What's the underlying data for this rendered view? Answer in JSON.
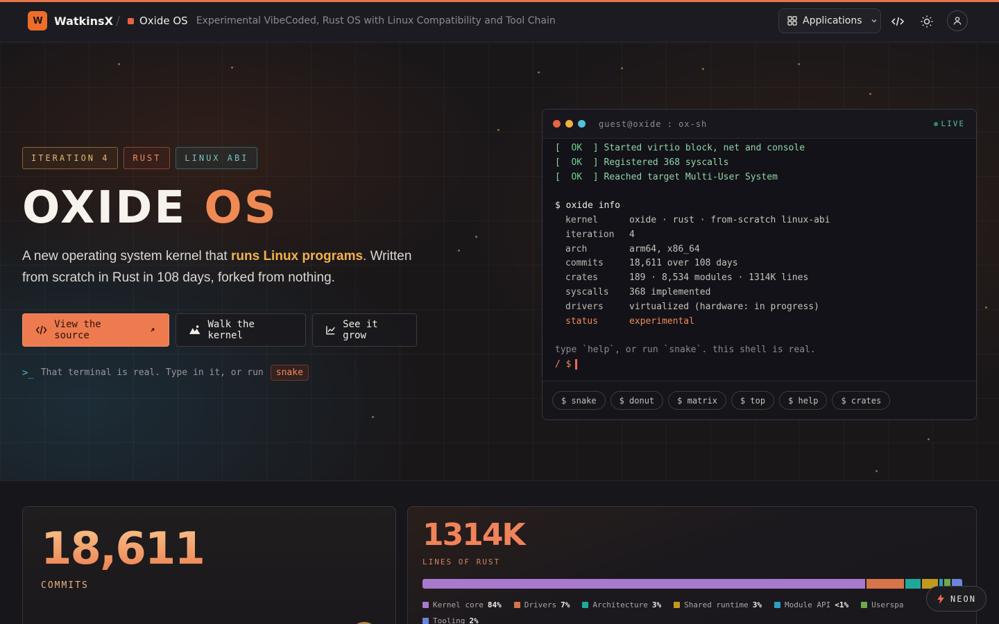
{
  "navbar": {
    "brand_name": "WatkinsX",
    "crumb_title": "Oxide OS",
    "crumb_desc": "Experimental VibeCoded, Rust OS with Linux Compatibility and Tool Chain",
    "apps_label": "Applications"
  },
  "hero": {
    "tags": [
      "ITERATION 4",
      "RUST",
      "LINUX ABI"
    ],
    "title_main": "OXIDE",
    "title_accent": "OS",
    "desc_before": "A new operating system kernel that ",
    "desc_highlight": "runs Linux programs",
    "desc_after": ". Written from scratch in Rust in 108 days, forked from nothing.",
    "buttons": {
      "source": "View the source",
      "walk": "Walk the kernel",
      "grow": "See it grow"
    },
    "hint_text": "That terminal is real. Type in it, or run",
    "hint_chip": "snake"
  },
  "terminal": {
    "title": "guest@oxide : ox-sh",
    "live": "LIVE",
    "boot": [
      {
        "status": "OK",
        "text": "Started virtio block, net and console"
      },
      {
        "status": "OK",
        "text": "Registered 368 syscalls"
      },
      {
        "status": "OK",
        "text": "Reached target Multi-User System"
      }
    ],
    "command": "$ oxide info",
    "info": [
      {
        "k": "kernel",
        "v": "oxide · rust · from-scratch linux-abi"
      },
      {
        "k": "iteration",
        "v": "4"
      },
      {
        "k": "arch",
        "v": "arm64, x86_64"
      },
      {
        "k": "commits",
        "v": "18,611 over 108 days"
      },
      {
        "k": "crates",
        "v": "189 · 8,534 modules · 1314K lines"
      },
      {
        "k": "syscalls",
        "v": "368 implemented"
      },
      {
        "k": "drivers",
        "v": "virtualized (hardware: in progress)"
      },
      {
        "k": "status",
        "v": "experimental"
      }
    ],
    "help_line": "type `help`, or run `snake`. this shell is real.",
    "prompt": "/ $",
    "chips": [
      "$ snake",
      "$ donut",
      "$ matrix",
      "$ top",
      "$ help",
      "$ crates"
    ]
  },
  "stats": {
    "commits_value": "18,611",
    "commits_label": "COMMITS",
    "lines_value": "1314K",
    "lines_label": "LINES OF RUST",
    "breakdown": [
      {
        "name": "Kernel core",
        "pct": "84%",
        "share": 84,
        "color": "#a879cc"
      },
      {
        "name": "Drivers",
        "pct": "7%",
        "share": 7,
        "color": "#d8744a"
      },
      {
        "name": "Architecture",
        "pct": "3%",
        "share": 3,
        "color": "#1fa89a"
      },
      {
        "name": "Shared runtime",
        "pct": "3%",
        "share": 3,
        "color": "#c09a1e"
      },
      {
        "name": "Module API",
        "pct": "<1%",
        "share": 0.6,
        "color": "#2e9dc4"
      },
      {
        "name": "Userspa",
        "pct": "",
        "share": 1.2,
        "color": "#6fa84a"
      },
      {
        "name": "Tooling",
        "pct": "2%",
        "share": 2,
        "color": "#6a86dc"
      }
    ]
  },
  "neon_label": "NEON"
}
